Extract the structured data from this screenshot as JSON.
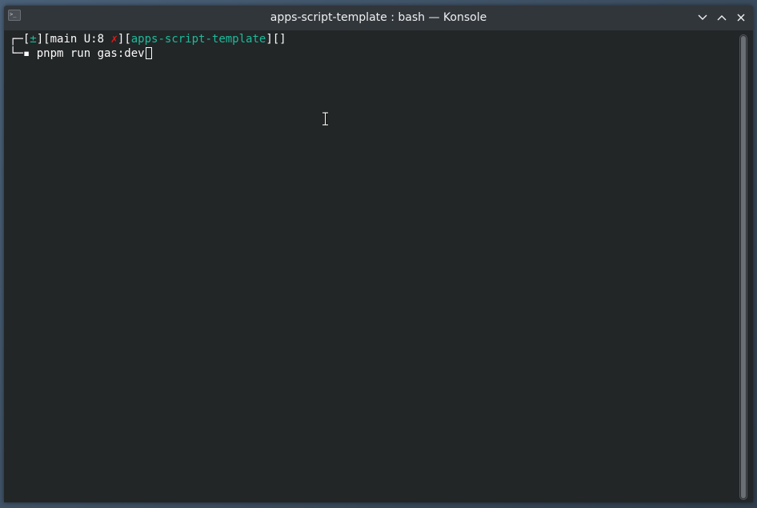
{
  "window": {
    "title": "apps-script-template : bash — Konsole",
    "app_icon": "terminal-icon",
    "app_icon_glyph": ">_",
    "buttons": {
      "minimize": "chevron-down-icon",
      "maximize": "chevron-up-icon",
      "close": "close-icon"
    }
  },
  "terminal": {
    "prompt": {
      "corner_top": "┌─",
      "open1": "[",
      "git_status_symbol": "±",
      "close1": "][",
      "branch": "main U:8 ",
      "dirty_mark": "✗",
      "close2": "][",
      "directory": "apps-script-template",
      "close3": "][]",
      "corner_bottom": "└─",
      "bullet": "▪ ",
      "command": "pnpm run gas:dev"
    }
  },
  "colors": {
    "background": "#232627",
    "titlebar": "#31363b",
    "text": "#fcfcfc",
    "accent_teal": "#1abc9c",
    "error_red": "#ed1515"
  }
}
